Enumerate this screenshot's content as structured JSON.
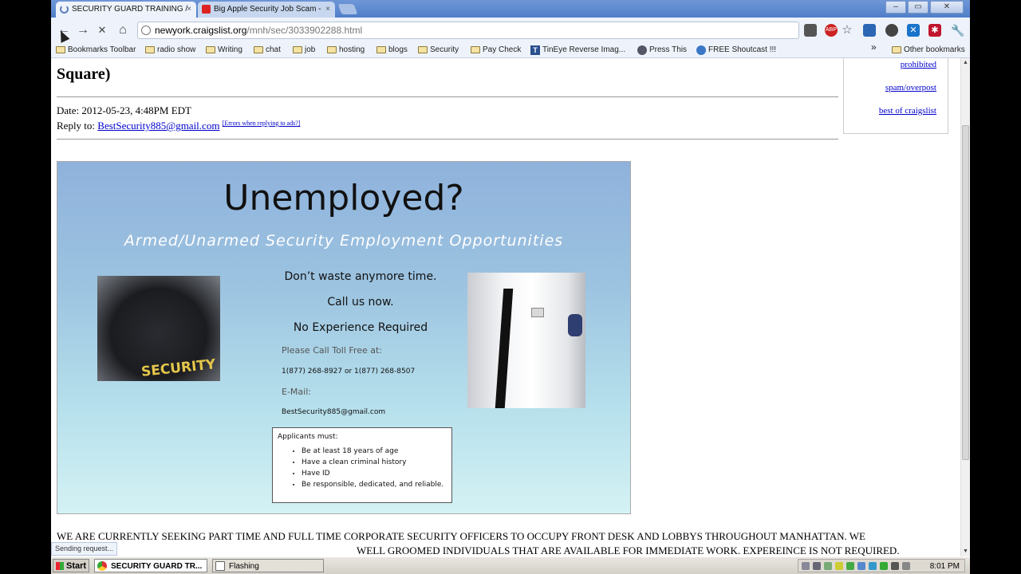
{
  "tabs": [
    {
      "label": "SECURITY GUARD TRAINING /",
      "close": "×"
    },
    {
      "label": "Big Apple Security Job Scam -",
      "close": "×"
    }
  ],
  "window": {
    "minimize": "–",
    "maximize": "▭",
    "close": "✕"
  },
  "toolbar": {
    "back": "←",
    "forward": "→",
    "stop": "✕",
    "home": "⌂",
    "url_host": "newyork.craigslist.org",
    "url_path": "/mnh/sec/3033902288.html"
  },
  "bookmarks": [
    "Bookmarks Toolbar",
    "radio show",
    "Writing",
    "chat",
    "job",
    "hosting",
    "blogs",
    "Security",
    "Pay Check",
    "TinEye Reverse Imag...",
    "Press This",
    "FREE Shoutcast !!!"
  ],
  "bookmarks_more": "»",
  "other_bookmarks": "Other bookmarks",
  "page": {
    "title": "Square)",
    "date_label": "Date:",
    "date_value": "2012-05-23, 4:48PM EDT",
    "reply_label": "Reply to:",
    "reply_email": "BestSecurity885@gmail.com",
    "reply_errors": "[Errors when replying to ads?]",
    "side_links": [
      "prohibited",
      "spam/overpost",
      "best of craigslist"
    ],
    "flyer": {
      "headline": "Unemployed?",
      "subheadline": "Armed/Unarmed Security Employment Opportunities",
      "line1": "Don’t waste anymore time.",
      "line2": "Call us now.",
      "line3": "No Experience Required",
      "call_label": "Please Call Toll Free at:",
      "phones": "1(877) 268-8927 or 1(877) 268-8507",
      "email_label": "E-Mail:",
      "email": "BestSecurity885@gmail.com",
      "security_patch": "SECURITY",
      "applicants_title": "Applicants must:",
      "applicants": [
        "Be at least 18 years of age",
        "Have a clean criminal history",
        "Have ID",
        "Be responsible, dedicated, and reliable."
      ]
    },
    "body_line1": "WE ARE CURRENTLY SEEKING PART TIME AND FULL TIME CORPORATE SECURITY OFFICERS TO OCCUPY FRONT DESK AND LOBBYS THROUGHOUT MANHATTAN. WE",
    "body_line2": "WELL GROOMED INDIVIDUALS THAT ARE AVAILABLE FOR IMMEDIATE WORK. EXPEREINCE IS NOT REQUIRED."
  },
  "status": "Sending request...",
  "taskbar": {
    "start": "Start",
    "tasks": [
      "SECURITY GUARD TR...",
      "Flashing"
    ],
    "clock": "8:01 PM"
  }
}
